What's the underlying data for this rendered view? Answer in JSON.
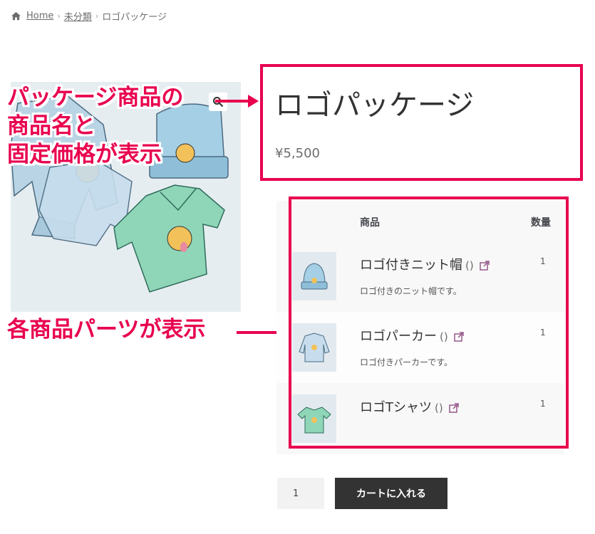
{
  "breadcrumb": {
    "home": "Home",
    "category": "未分類",
    "current": "ロゴパッケージ"
  },
  "product": {
    "title": "ロゴパッケージ",
    "price": "¥5,500"
  },
  "table": {
    "header_product": "商品",
    "header_qty": "数量",
    "items": [
      {
        "name": "ロゴ付きニット帽",
        "paren": "()",
        "desc": "ロゴ付きのニット帽です。",
        "qty": "1"
      },
      {
        "name": "ロゴパーカー",
        "paren": "()",
        "desc": "ロゴ付きパーカーです。",
        "qty": "1"
      },
      {
        "name": "ロゴTシャツ",
        "paren": "()",
        "desc": "",
        "qty": "1"
      }
    ]
  },
  "cart": {
    "qty": "1",
    "button": "カートに入れる"
  },
  "annotations": {
    "line1": "パッケージ商品の",
    "line2": "商品名と",
    "line3": "固定価格が表示",
    "line4": "各商品パーツが表示"
  },
  "colors": {
    "accent": "#e8004e",
    "button_bg": "#333333",
    "link_icon": "#96588a"
  },
  "icons": {
    "home": "home-icon",
    "zoom": "magnifier-icon",
    "external": "external-link-icon"
  }
}
